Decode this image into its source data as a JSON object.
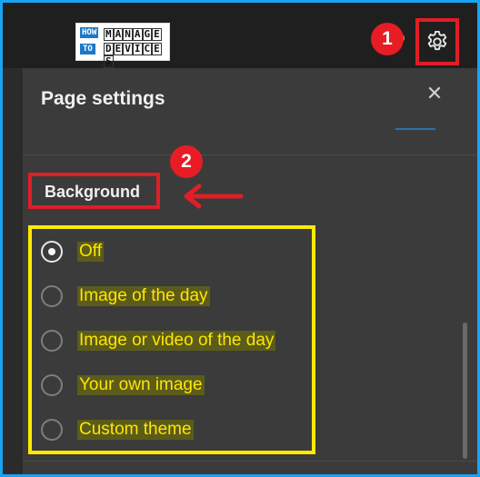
{
  "logo": {
    "how": "HOW",
    "to": "TO",
    "manage": [
      "M",
      "A",
      "N",
      "A",
      "G",
      "E"
    ],
    "devices": [
      "D",
      "E",
      "V",
      "I",
      "C",
      "E",
      "S"
    ]
  },
  "annotations": {
    "step1": "1",
    "step2": "2",
    "annotation_red": "#e01e26",
    "highlight_yellow": "#ffea00"
  },
  "panel": {
    "title": "Page settings",
    "close_label": "✕",
    "section_label": "Background"
  },
  "options": [
    {
      "label": "Off",
      "checked": true
    },
    {
      "label": "Image of the day",
      "checked": false
    },
    {
      "label": "Image or video of the day",
      "checked": false
    },
    {
      "label": "Your own image",
      "checked": false
    },
    {
      "label": "Custom theme",
      "checked": false
    }
  ],
  "icons": {
    "settings": "gear-icon",
    "close": "close-icon",
    "arrow": "arrow-icon"
  },
  "colors": {
    "frame_border": "#1aa3f2",
    "panel_bg": "#3b3b3b",
    "topbar_bg": "#1f1f1f"
  }
}
